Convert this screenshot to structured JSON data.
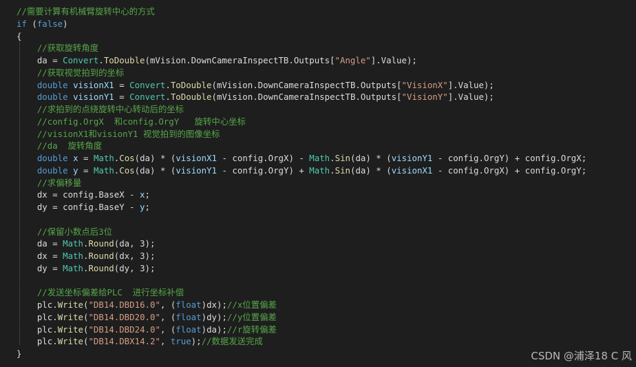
{
  "colors": {
    "background": "#1e1e1e",
    "keyword": "#569cd6",
    "type": "#4ec9b0",
    "method": "#dcdcaa",
    "comment": "#57a64a",
    "string": "#d69d85",
    "identifier": "#dcdcdc"
  },
  "lines": [
    [
      {
        "t": "comment",
        "v": "//需要计算有机械臂旋转中心的方式"
      }
    ],
    [
      {
        "t": "keyword",
        "v": "if"
      },
      {
        "t": "plain",
        "v": " ("
      },
      {
        "t": "keyword",
        "v": "false"
      },
      {
        "t": "plain",
        "v": ")"
      }
    ],
    [
      {
        "t": "plain",
        "v": "{"
      }
    ],
    [
      {
        "t": "plain",
        "v": "    "
      },
      {
        "t": "comment",
        "v": "//获取旋转角度"
      }
    ],
    [
      {
        "t": "plain",
        "v": "    da = "
      },
      {
        "t": "type",
        "v": "Convert"
      },
      {
        "t": "plain",
        "v": "."
      },
      {
        "t": "method",
        "v": "ToDouble"
      },
      {
        "t": "plain",
        "v": "(mVision.DownCameraInspectTB.Outputs["
      },
      {
        "t": "string",
        "v": "\"Angle\""
      },
      {
        "t": "plain",
        "v": "].Value);"
      }
    ],
    [
      {
        "t": "plain",
        "v": "    "
      },
      {
        "t": "comment",
        "v": "//获取视觉拍到的坐标"
      }
    ],
    [
      {
        "t": "plain",
        "v": "    "
      },
      {
        "t": "keyword",
        "v": "double"
      },
      {
        "t": "plain",
        "v": " "
      },
      {
        "t": "param",
        "v": "visionX1"
      },
      {
        "t": "plain",
        "v": " = "
      },
      {
        "t": "type",
        "v": "Convert"
      },
      {
        "t": "plain",
        "v": "."
      },
      {
        "t": "method",
        "v": "ToDouble"
      },
      {
        "t": "plain",
        "v": "(mVision.DownCameraInspectTB.Outputs["
      },
      {
        "t": "string",
        "v": "\"VisionX\""
      },
      {
        "t": "plain",
        "v": "].Value);"
      }
    ],
    [
      {
        "t": "plain",
        "v": "    "
      },
      {
        "t": "keyword",
        "v": "double"
      },
      {
        "t": "plain",
        "v": " "
      },
      {
        "t": "param",
        "v": "visionY1"
      },
      {
        "t": "plain",
        "v": " = "
      },
      {
        "t": "type",
        "v": "Convert"
      },
      {
        "t": "plain",
        "v": "."
      },
      {
        "t": "method",
        "v": "ToDouble"
      },
      {
        "t": "plain",
        "v": "(mVision.DownCameraInspectTB.Outputs["
      },
      {
        "t": "string",
        "v": "\"VisionY\""
      },
      {
        "t": "plain",
        "v": "].Value);"
      }
    ],
    [
      {
        "t": "plain",
        "v": "    "
      },
      {
        "t": "comment",
        "v": "//求拍到的点绕旋转中心转动后的坐标"
      }
    ],
    [
      {
        "t": "plain",
        "v": "    "
      },
      {
        "t": "comment",
        "v": "//config.OrgX  和config.OrgY   旋转中心坐标"
      }
    ],
    [
      {
        "t": "plain",
        "v": "    "
      },
      {
        "t": "comment",
        "v": "//visionX1和visionY1 视觉拍到的图像坐标"
      }
    ],
    [
      {
        "t": "plain",
        "v": "    "
      },
      {
        "t": "comment",
        "v": "//da  旋转角度"
      }
    ],
    [
      {
        "t": "plain",
        "v": "    "
      },
      {
        "t": "keyword",
        "v": "double"
      },
      {
        "t": "plain",
        "v": " "
      },
      {
        "t": "param",
        "v": "x"
      },
      {
        "t": "plain",
        "v": " = "
      },
      {
        "t": "type",
        "v": "Math"
      },
      {
        "t": "plain",
        "v": "."
      },
      {
        "t": "method",
        "v": "Cos"
      },
      {
        "t": "plain",
        "v": "(da) * ("
      },
      {
        "t": "param",
        "v": "visionX1"
      },
      {
        "t": "plain",
        "v": " - config.OrgX) - "
      },
      {
        "t": "type",
        "v": "Math"
      },
      {
        "t": "plain",
        "v": "."
      },
      {
        "t": "method",
        "v": "Sin"
      },
      {
        "t": "plain",
        "v": "(da) * ("
      },
      {
        "t": "param",
        "v": "visionY1"
      },
      {
        "t": "plain",
        "v": " - config.OrgY) + config.OrgX;"
      }
    ],
    [
      {
        "t": "plain",
        "v": "    "
      },
      {
        "t": "keyword",
        "v": "double"
      },
      {
        "t": "plain",
        "v": " "
      },
      {
        "t": "param",
        "v": "y"
      },
      {
        "t": "plain",
        "v": " = "
      },
      {
        "t": "type",
        "v": "Math"
      },
      {
        "t": "plain",
        "v": "."
      },
      {
        "t": "method",
        "v": "Cos"
      },
      {
        "t": "plain",
        "v": "(da) * ("
      },
      {
        "t": "param",
        "v": "visionY1"
      },
      {
        "t": "plain",
        "v": " - config.OrgY) + "
      },
      {
        "t": "type",
        "v": "Math"
      },
      {
        "t": "plain",
        "v": "."
      },
      {
        "t": "method",
        "v": "Sin"
      },
      {
        "t": "plain",
        "v": "(da) * ("
      },
      {
        "t": "param",
        "v": "visionX1"
      },
      {
        "t": "plain",
        "v": " - config.OrgX) + config.OrgY;"
      }
    ],
    [
      {
        "t": "plain",
        "v": "    "
      },
      {
        "t": "comment",
        "v": "//求偏移量"
      }
    ],
    [
      {
        "t": "plain",
        "v": "    dx = config.BaseX - "
      },
      {
        "t": "param",
        "v": "x"
      },
      {
        "t": "plain",
        "v": ";"
      }
    ],
    [
      {
        "t": "plain",
        "v": "    dy = config.BaseY - "
      },
      {
        "t": "param",
        "v": "y"
      },
      {
        "t": "plain",
        "v": ";"
      }
    ],
    [
      {
        "t": "plain",
        "v": ""
      }
    ],
    [
      {
        "t": "plain",
        "v": "    "
      },
      {
        "t": "comment",
        "v": "//保留小数点后3位"
      }
    ],
    [
      {
        "t": "plain",
        "v": "    da = "
      },
      {
        "t": "type",
        "v": "Math"
      },
      {
        "t": "plain",
        "v": "."
      },
      {
        "t": "method",
        "v": "Round"
      },
      {
        "t": "plain",
        "v": "(da, 3);"
      }
    ],
    [
      {
        "t": "plain",
        "v": "    dx = "
      },
      {
        "t": "type",
        "v": "Math"
      },
      {
        "t": "plain",
        "v": "."
      },
      {
        "t": "method",
        "v": "Round"
      },
      {
        "t": "plain",
        "v": "(dx, 3);"
      }
    ],
    [
      {
        "t": "plain",
        "v": "    dy = "
      },
      {
        "t": "type",
        "v": "Math"
      },
      {
        "t": "plain",
        "v": "."
      },
      {
        "t": "method",
        "v": "Round"
      },
      {
        "t": "plain",
        "v": "(dy, 3);"
      }
    ],
    [
      {
        "t": "plain",
        "v": ""
      }
    ],
    [
      {
        "t": "plain",
        "v": "    "
      },
      {
        "t": "comment",
        "v": "//发送坐标偏差给PLC  进行坐标补偿"
      }
    ],
    [
      {
        "t": "plain",
        "v": "    plc."
      },
      {
        "t": "method",
        "v": "Write"
      },
      {
        "t": "plain",
        "v": "("
      },
      {
        "t": "string",
        "v": "\"DB14.DBD16.0\""
      },
      {
        "t": "plain",
        "v": ", ("
      },
      {
        "t": "keyword",
        "v": "float"
      },
      {
        "t": "plain",
        "v": ")dx);"
      },
      {
        "t": "comment",
        "v": "//x位置偏差"
      }
    ],
    [
      {
        "t": "plain",
        "v": "    plc."
      },
      {
        "t": "method",
        "v": "Write"
      },
      {
        "t": "plain",
        "v": "("
      },
      {
        "t": "string",
        "v": "\"DB14.DBD20.0\""
      },
      {
        "t": "plain",
        "v": ", ("
      },
      {
        "t": "keyword",
        "v": "float"
      },
      {
        "t": "plain",
        "v": ")dy);"
      },
      {
        "t": "comment",
        "v": "//y位置偏差"
      }
    ],
    [
      {
        "t": "plain",
        "v": "    plc."
      },
      {
        "t": "method",
        "v": "Write"
      },
      {
        "t": "plain",
        "v": "("
      },
      {
        "t": "string",
        "v": "\"DB14.DBD24.0\""
      },
      {
        "t": "plain",
        "v": ", ("
      },
      {
        "t": "keyword",
        "v": "float"
      },
      {
        "t": "plain",
        "v": ")da);"
      },
      {
        "t": "comment",
        "v": "//r旋转偏差"
      }
    ],
    [
      {
        "t": "plain",
        "v": "    plc."
      },
      {
        "t": "method",
        "v": "Write"
      },
      {
        "t": "plain",
        "v": "("
      },
      {
        "t": "string",
        "v": "\"DB14.DBX14.2\""
      },
      {
        "t": "plain",
        "v": ", "
      },
      {
        "t": "keyword",
        "v": "true"
      },
      {
        "t": "plain",
        "v": ");"
      },
      {
        "t": "comment",
        "v": "//数据发送完成"
      }
    ],
    [
      {
        "t": "plain",
        "v": "}"
      }
    ]
  ],
  "watermark": "CSDN @浦泽18 C 风"
}
